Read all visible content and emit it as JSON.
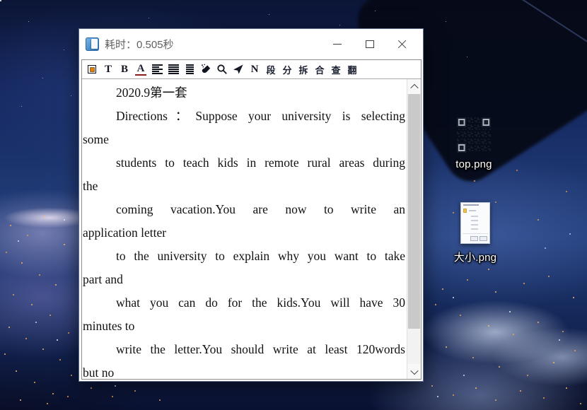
{
  "window": {
    "title": "耗时：0.505秒"
  },
  "toolbar": {
    "items": [
      {
        "name": "border-frame-icon",
        "kind": "frame"
      },
      {
        "name": "text-tool-icon",
        "kind": "glyph",
        "glyph": "T"
      },
      {
        "name": "bold-icon",
        "kind": "glyph",
        "glyph": "B"
      },
      {
        "name": "font-color-icon",
        "kind": "glyph",
        "glyph": "A",
        "underline": true
      },
      {
        "name": "align-left-icon",
        "kind": "align-left"
      },
      {
        "name": "align-justify-icon",
        "kind": "align-justify"
      },
      {
        "name": "align-center-icon",
        "kind": "align-center"
      },
      {
        "name": "spray-icon",
        "kind": "spray"
      },
      {
        "name": "search-icon",
        "kind": "search"
      },
      {
        "name": "send-icon",
        "kind": "send"
      },
      {
        "name": "n-tool-icon",
        "kind": "glyph",
        "glyph": "N"
      },
      {
        "name": "paragraph-tool",
        "kind": "glyph",
        "glyph": "段",
        "cn": true
      },
      {
        "name": "split-tool",
        "kind": "glyph",
        "glyph": "分",
        "cn": true
      },
      {
        "name": "split-apart-tool",
        "kind": "glyph",
        "glyph": "拆",
        "cn": true
      },
      {
        "name": "merge-tool",
        "kind": "glyph",
        "glyph": "合",
        "cn": true
      },
      {
        "name": "lookup-tool",
        "kind": "glyph",
        "glyph": "查",
        "cn": true
      },
      {
        "name": "translate-tool",
        "kind": "glyph",
        "glyph": "翻",
        "cn": true
      }
    ]
  },
  "document": {
    "lines": [
      {
        "text": "2020.9第一套",
        "indent": true,
        "justify": false
      },
      {
        "text": "Directions：Suppose your university is selecting",
        "indent": true,
        "justify": true
      },
      {
        "text": "some",
        "indent": false,
        "justify": false
      },
      {
        "text": "students to teach kids in remote rural areas during",
        "indent": true,
        "justify": true
      },
      {
        "text": "the",
        "indent": false,
        "justify": false
      },
      {
        "text": "coming vacation.You are now to write an",
        "indent": true,
        "justify": true
      },
      {
        "text": "application letter",
        "indent": false,
        "justify": false
      },
      {
        "text": "to the university to explain why you want to take",
        "indent": true,
        "justify": true
      },
      {
        "text": "part and",
        "indent": false,
        "justify": false
      },
      {
        "text": "what you can do for the kids.You will have 30",
        "indent": true,
        "justify": true
      },
      {
        "text": "minutes to",
        "indent": false,
        "justify": false
      },
      {
        "text": "write the letter.You should write at least 120words",
        "indent": true,
        "justify": true
      },
      {
        "text": "but no",
        "indent": false,
        "justify": false
      }
    ]
  },
  "desktop": {
    "icons": [
      {
        "label": "top.png"
      },
      {
        "label": "大小.png"
      }
    ]
  },
  "colors": {
    "frame_center_orange": "#e07f00",
    "font_color_underline_red": "#8b1a1a",
    "title_text_gray": "#5f5f5f"
  }
}
